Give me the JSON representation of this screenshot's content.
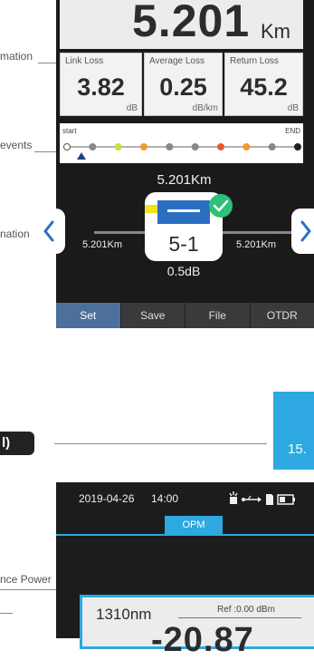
{
  "labels": {
    "information_1": "mation",
    "events": "events",
    "information_2": "nation",
    "reference_power": "nce Power"
  },
  "otdr": {
    "distance_value": "5.201",
    "distance_unit": "Km",
    "loss_cards": [
      {
        "title": "Link Loss",
        "value": "3.82",
        "unit": "dB"
      },
      {
        "title": "Average Loss",
        "value": "0.25",
        "unit": "dB/km"
      },
      {
        "title": "Return Loss",
        "value": "45.2",
        "unit": "dB"
      }
    ],
    "events": {
      "start_label": "start",
      "end_label": "END",
      "dot_colors": [
        "#ffffff",
        "#888888",
        "#c8e03c",
        "#f29a2e",
        "#888888",
        "#888888",
        "#e55a2b",
        "#f29a2e",
        "#888888",
        "#222222"
      ]
    },
    "map": {
      "total_distance": "5.201Km",
      "left_distance": "5.201Km",
      "right_distance": "5.201Km",
      "event_name": "5-1",
      "event_loss": "0.5dB",
      "status": "pass-check-icon"
    },
    "menu": [
      "Set",
      "Save",
      "File",
      "OTDR"
    ],
    "menu_active": 0
  },
  "section": {
    "tag": "l)",
    "page_number": "15."
  },
  "opm": {
    "date": "2019-04-26",
    "time": "14:00",
    "mode_tab": "OPM",
    "wavelength": "1310nm",
    "ref_text": "Ref :0.00 dBm",
    "power_value": "-20.87",
    "status_icons": [
      "light-source-icon",
      "usb-icon",
      "sd-card-icon",
      "battery-icon"
    ]
  },
  "colors": {
    "accent_blue": "#2da8e0",
    "active_menu": "#4d6f9c",
    "check_green": "#2bc17a",
    "connector_yellow": "#f2e21c",
    "connector_blue": "#2a6fc0"
  }
}
